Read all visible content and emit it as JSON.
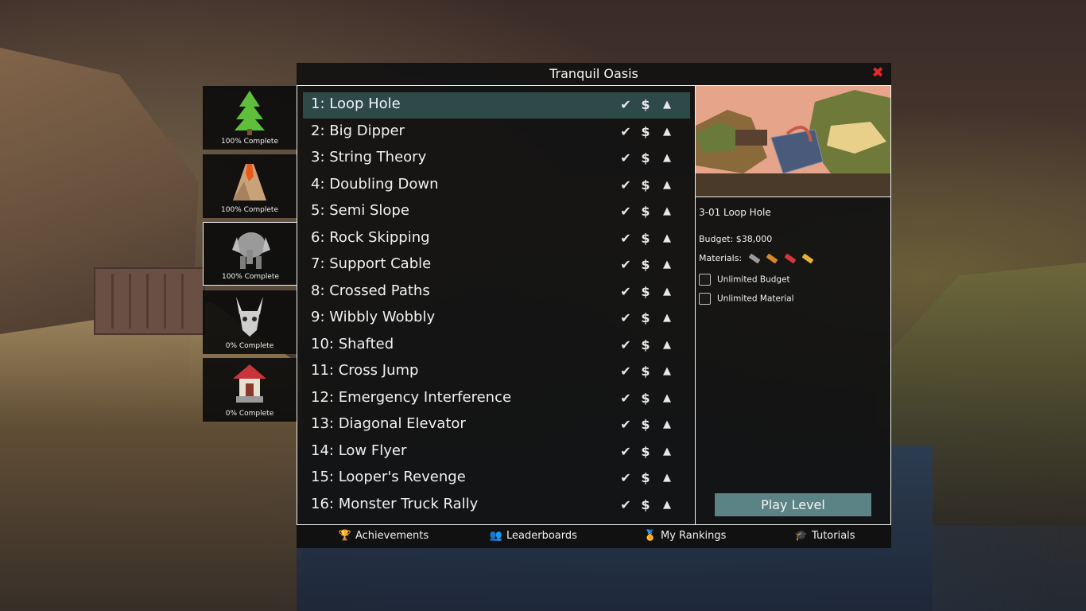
{
  "window": {
    "title": "Tranquil Oasis"
  },
  "worlds": [
    {
      "icon": "pine-tree-icon",
      "progress": "100% Complete",
      "active": false
    },
    {
      "icon": "volcano-icon",
      "progress": "100% Complete",
      "active": false
    },
    {
      "icon": "elephant-icon",
      "progress": "100% Complete",
      "active": true
    },
    {
      "icon": "horned-skull-icon",
      "progress": "0% Complete",
      "active": false
    },
    {
      "icon": "pagoda-icon",
      "progress": "0% Complete",
      "active": false
    }
  ],
  "levels": [
    {
      "label": "1: Loop Hole",
      "selected": true
    },
    {
      "label": "2: Big Dipper"
    },
    {
      "label": "3: String Theory"
    },
    {
      "label": "4: Doubling Down"
    },
    {
      "label": "5: Semi Slope"
    },
    {
      "label": "6: Rock Skipping"
    },
    {
      "label": "7: Support Cable"
    },
    {
      "label": "8: Crossed Paths"
    },
    {
      "label": "9: Wibbly Wobbly"
    },
    {
      "label": "10: Shafted"
    },
    {
      "label": "11: Cross Jump"
    },
    {
      "label": "12: Emergency Interference"
    },
    {
      "label": "13: Diagonal Elevator"
    },
    {
      "label": "14: Low Flyer"
    },
    {
      "label": "15: Looper's Revenge"
    },
    {
      "label": "16: Monster Truck Rally"
    }
  ],
  "row_icons": {
    "check": "✔",
    "dollar": "$",
    "triangle": "▲"
  },
  "detail": {
    "title": "3-01 Loop Hole",
    "budget": "Budget: $38,000",
    "materials_label": "Materials:",
    "materials": [
      {
        "name": "road",
        "color": "#9a9a9a"
      },
      {
        "name": "wood",
        "color": "#d9862a"
      },
      {
        "name": "steel",
        "color": "#d8343a"
      },
      {
        "name": "rope",
        "color": "#e2b23a"
      }
    ],
    "unlimited_budget": "Unlimited Budget",
    "unlimited_material": "Unlimited Material",
    "play_button": "Play Level"
  },
  "footer": {
    "achievements": "Achievements",
    "leaderboards": "Leaderboards",
    "my_rankings": "My Rankings",
    "tutorials": "Tutorials"
  },
  "close_icon": "✖"
}
